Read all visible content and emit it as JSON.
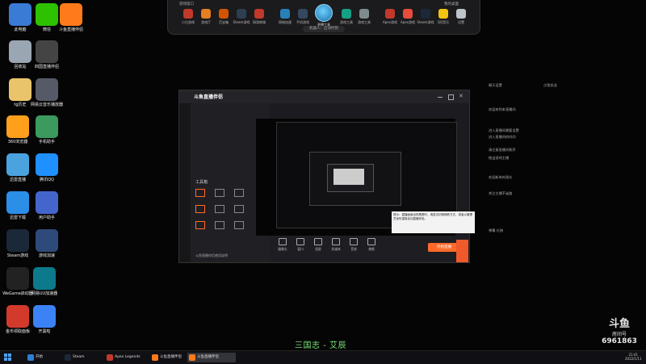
{
  "desktop_icons": [
    {
      "label": "此电脑",
      "color": "#3a7bd5"
    },
    {
      "label": "微信",
      "color": "#2dc100"
    },
    {
      "label": "斗鱼直播伴侣",
      "color": "#ff7a1a"
    },
    {
      "label": "回收站",
      "color": "#9aa6b2"
    },
    {
      "label": "四国直播伴侣",
      "color": "#444444"
    },
    {
      "label": "tg历史",
      "color": "#e9c46a"
    },
    {
      "label": "网易云音乐播放器",
      "color": "#555a66"
    },
    {
      "label": "360浏览器",
      "color": "#ff9f1c"
    },
    {
      "label": "手机助手",
      "color": "#3c9a5f"
    },
    {
      "label": "迅雷直播",
      "color": "#4aa3df"
    },
    {
      "label": "腾讯QQ",
      "color": "#1e90ff"
    },
    {
      "label": "迅雷下载",
      "color": "#2b8fe8"
    },
    {
      "label": "用户助手",
      "color": "#4466cc"
    },
    {
      "label": "Steam游戏",
      "color": "#1b2838"
    },
    {
      "label": "游戏加速",
      "color": "#2e4a7a"
    },
    {
      "label": "WeGame启动器",
      "color": "#222222"
    },
    {
      "label": "网易UU加速器",
      "color": "#0c7a8a"
    },
    {
      "label": "金币领取面板",
      "color": "#d33a2c"
    },
    {
      "label": "开黑啦",
      "color": "#3b82f6"
    }
  ],
  "dock": {
    "left_section_title": "游戏窗口",
    "right_section_title": "我的桌面",
    "center_label": "直播工具",
    "pill_text": "机器人：启动时刻",
    "apps": [
      {
        "label": "小白游戏",
        "color": "#c0392b"
      },
      {
        "label": "游戏厅",
        "color": "#e67e22"
      },
      {
        "label": "百宝箱",
        "color": "#d35400"
      },
      {
        "label": "Steam游戏",
        "color": "#2c3e50"
      },
      {
        "label": "网游商城",
        "color": "#c0392b"
      },
      {
        "label": "网络加速",
        "color": "#2980b9"
      },
      {
        "label": "手机游戏",
        "color": "#34495e"
      },
      {
        "label": "游戏工具",
        "color": "#16a085"
      },
      {
        "label": "游戏工具",
        "color": "#7f8c8d"
      },
      {
        "label": "Apex游戏",
        "color": "#c0392b"
      },
      {
        "label": "Apex游戏",
        "color": "#e74c3c"
      },
      {
        "label": "Steam游戏",
        "color": "#1b2838"
      },
      {
        "label": "QQ音乐",
        "color": "#f1c40f"
      },
      {
        "label": "设置",
        "color": "#bdc3c7"
      }
    ]
  },
  "app_window": {
    "title": "斗鱼直播伴侣",
    "tools_label": "工具箱",
    "bottom_note": "斗鱼直播伴侣使用说明",
    "toolbar": [
      {
        "label": "摄像头"
      },
      {
        "label": "窗口"
      },
      {
        "label": "投屏"
      },
      {
        "label": "多媒体"
      },
      {
        "label": "音效"
      },
      {
        "label": "美颜"
      }
    ],
    "start_button": "开始直播"
  },
  "chat": {
    "header_left": "聊天设置",
    "header_right": "点我发送",
    "lines": [
      "欢迎来到本直播间",
      "进入直播间需要设置",
      "进入直播间的时间",
      "请注意直播间秩序",
      "推出游戏主播",
      "欢迎新来的观众",
      "关注主播不迷路",
      "弹幕 礼物"
    ]
  },
  "tooltip": {
    "text": "提示：直播画面出现黑屏时，请尝试切换捕获方式，或者以管理员身份重新启动直播伴侣。"
  },
  "subtitle": {
    "left": "三国志",
    "sep": " - ",
    "right": "艾辰"
  },
  "watermark": {
    "brand": "斗鱼",
    "room_label": "房间号",
    "room_number": "6961863"
  },
  "taskbar": {
    "items": [
      {
        "label": "开始",
        "color": "#2d7fd3",
        "active": false
      },
      {
        "label": "Steam",
        "color": "#1b2838",
        "active": false
      },
      {
        "label": "Apex Legends",
        "color": "#c0392b",
        "active": false
      },
      {
        "label": "斗鱼直播伴侣",
        "color": "#ff7a1a",
        "active": false
      },
      {
        "label": "斗鱼直播伴侣",
        "color": "#ff7a1a",
        "active": true
      }
    ],
    "time": "21:41",
    "date": "2022/1/11"
  }
}
